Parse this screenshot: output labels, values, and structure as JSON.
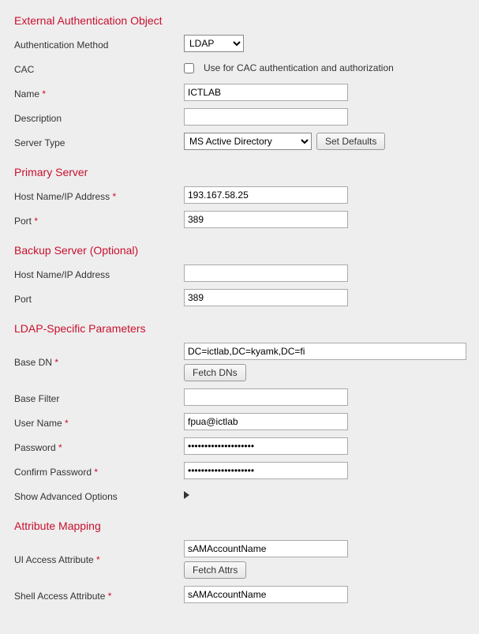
{
  "ext_obj": {
    "title": "External Authentication Object",
    "auth_method_label": "Authentication Method",
    "auth_method_value": "LDAP",
    "cac_label": "CAC",
    "cac_text": "Use for CAC authentication and authorization",
    "name_label": "Name",
    "name_value": "ICTLAB",
    "desc_label": "Description",
    "desc_value": "",
    "server_type_label": "Server Type",
    "server_type_value": "MS Active Directory",
    "set_defaults_btn": "Set Defaults"
  },
  "primary": {
    "title": "Primary Server",
    "host_label": "Host Name/IP Address",
    "host_value": "193.167.58.25",
    "port_label": "Port",
    "port_value": "389"
  },
  "backup": {
    "title": "Backup Server (Optional)",
    "host_label": "Host Name/IP Address",
    "host_value": "",
    "port_label": "Port",
    "port_value": "389"
  },
  "ldap": {
    "title": "LDAP-Specific Parameters",
    "base_dn_label": "Base DN",
    "base_dn_value": "DC=ictlab,DC=kyamk,DC=fi",
    "fetch_dns_btn": "Fetch DNs",
    "base_filter_label": "Base Filter",
    "base_filter_value": "",
    "user_label": "User Name",
    "user_value": "fpua@ictlab",
    "pass_label": "Password",
    "pass_value": "••••••••••••••••••••",
    "cpass_label": "Confirm Password",
    "cpass_value": "••••••••••••••••••••",
    "adv_label": "Show Advanced Options"
  },
  "attr": {
    "title": "Attribute Mapping",
    "ui_label": "UI Access Attribute",
    "ui_value": "sAMAccountName",
    "fetch_attrs_btn": "Fetch Attrs",
    "shell_label": "Shell Access Attribute",
    "shell_value": "sAMAccountName"
  },
  "asterisk": " *"
}
